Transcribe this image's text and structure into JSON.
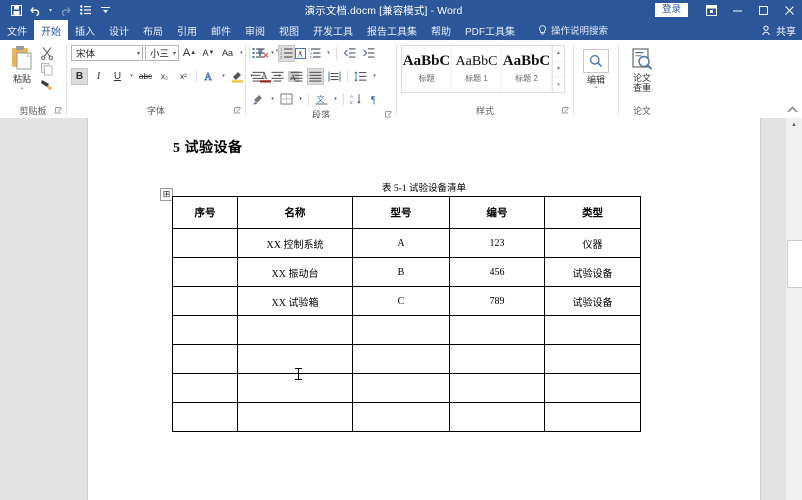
{
  "window": {
    "title": "演示文档.docm [兼容模式]  -  Word",
    "signin_label": "登录",
    "ribbon_display_icon": "ribbon-display-options-icon",
    "minimize_icon": "minimize-icon",
    "maximize_icon": "maximize-icon",
    "close_icon": "close-icon"
  },
  "quick_access": {
    "save_icon": "save-icon",
    "undo_icon": "undo-icon",
    "undo_caret": "▾",
    "redo_icon": "redo-icon",
    "list_icon": "bullet-list-icon",
    "customize_icon": "customize-qat-icon"
  },
  "tabs": [
    {
      "label": "文件",
      "active": false
    },
    {
      "label": "开始",
      "active": true
    },
    {
      "label": "插入",
      "active": false
    },
    {
      "label": "设计",
      "active": false
    },
    {
      "label": "布局",
      "active": false
    },
    {
      "label": "引用",
      "active": false
    },
    {
      "label": "邮件",
      "active": false
    },
    {
      "label": "审阅",
      "active": false
    },
    {
      "label": "视图",
      "active": false
    },
    {
      "label": "开发工具",
      "active": false
    },
    {
      "label": "报告工具集",
      "active": false
    },
    {
      "label": "帮助",
      "active": false
    },
    {
      "label": "PDF工具集",
      "active": false
    }
  ],
  "tell_me": "操作说明搜索",
  "share": "共享",
  "ribbon": {
    "clipboard": {
      "group_label": "剪贴板",
      "paste_label": "粘贴",
      "paste_caret": "⌄",
      "cut_icon": "scissors-icon",
      "copy_icon": "copy-icon",
      "format_painter_icon": "format-painter-icon",
      "dialog_launcher": "⌐"
    },
    "font": {
      "group_label": "字体",
      "font_name": "宋体",
      "font_size": "小三",
      "grow_font": "A",
      "shrink_font": "A",
      "change_case": "Aa",
      "clear_format_icon": "clear-formatting-icon",
      "phonetic_icon": "phonetic-guide-icon",
      "enclose_icon": "enclose-character-icon",
      "bold": "B",
      "italic": "I",
      "underline": "U",
      "strikethrough": "abc",
      "subscript": "x₂",
      "superscript": "x²",
      "text_effects_icon": "text-effects-icon",
      "highlight_icon": "highlight-color-icon",
      "font_color_icon": "font-color-icon",
      "char_shading_icon": "character-shading-icon",
      "char_border_icon": "character-border-icon"
    },
    "paragraph": {
      "group_label": "段落",
      "bullets_icon": "bullet-list-icon",
      "numbering_icon": "numbered-list-icon",
      "multilevel_icon": "multilevel-list-icon",
      "decrease_indent_icon": "decrease-indent-icon",
      "increase_indent_icon": "increase-indent-icon",
      "align_left_icon": "align-left-icon",
      "align_center_icon": "align-center-icon",
      "align_right_icon": "align-right-icon",
      "justify_icon": "justify-icon",
      "distribute_icon": "distribute-icon",
      "line_spacing_icon": "line-spacing-icon",
      "shading_icon": "shading-icon",
      "borders_icon": "borders-icon",
      "asian_layout_icon": "asian-layout-icon",
      "sort_icon": "sort-icon",
      "show_marks_icon": "show-paragraph-marks-icon",
      "dialog_launcher": "⌐"
    },
    "styles": {
      "group_label": "样式",
      "items": [
        {
          "preview": "AaBbC",
          "name": "标题"
        },
        {
          "preview": "AaBbC",
          "name": "标题 1"
        },
        {
          "preview": "AaBbC",
          "name": "标题 2"
        }
      ],
      "dialog_launcher": "⌐"
    },
    "editing": {
      "group_label": "",
      "label": "编辑",
      "caret": "⌄",
      "icon": "find-magnifier-icon"
    },
    "thesis": {
      "group_label": "论文",
      "label_line1": "论文",
      "label_line2": "查重",
      "icon": "document-check-icon"
    },
    "collapse_icon": "collapse-ribbon-icon"
  },
  "document": {
    "heading": "5  试验设备",
    "table_caption": "表 5-1    试验设备清单",
    "table_move_handle": "⊞",
    "table": {
      "headers": [
        "序号",
        "名称",
        "型号",
        "编号",
        "类型"
      ],
      "rows": [
        [
          "",
          "XX 控制系统",
          "A",
          "123",
          "仪器"
        ],
        [
          "",
          "XX 振动台",
          "B",
          "456",
          "试验设备"
        ],
        [
          "",
          "XX 试验箱",
          "C",
          "789",
          "试验设备"
        ],
        [
          "",
          "",
          "",
          "",
          ""
        ],
        [
          "",
          "",
          "",
          "",
          ""
        ],
        [
          "",
          "",
          "",
          "",
          ""
        ],
        [
          "",
          "",
          "",
          "",
          ""
        ]
      ]
    }
  },
  "scrollbar": {
    "up_arrow": "▲"
  },
  "colors": {
    "word_blue": "#2b579a",
    "ribbon_bg": "#ffffff",
    "canvas": "#e3e3e3"
  }
}
